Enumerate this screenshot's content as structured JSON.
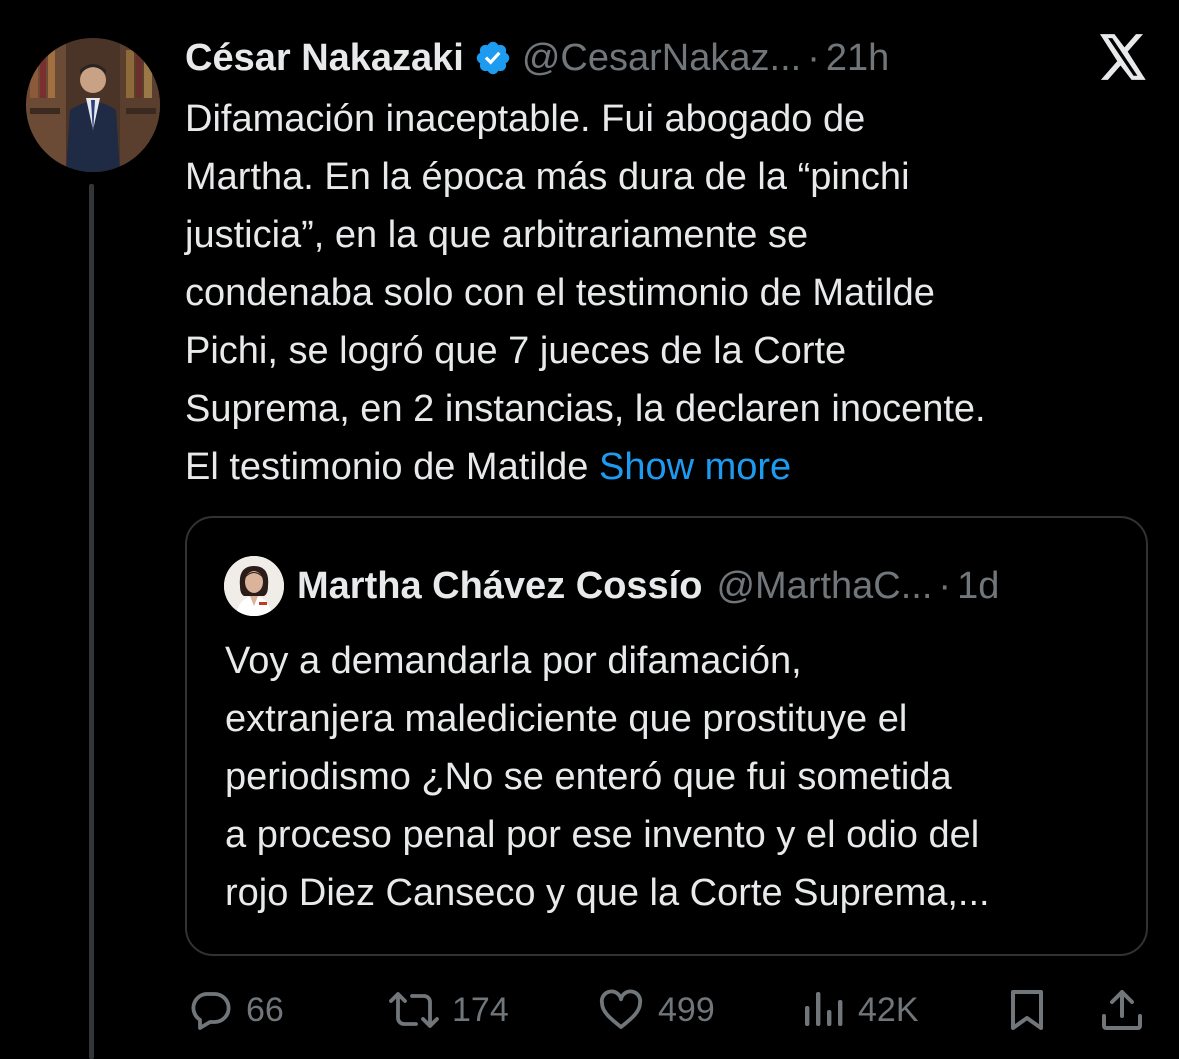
{
  "app": {
    "logo_icon": "x-logo-icon"
  },
  "tweet": {
    "author_name": "César Nakazaki",
    "verified_icon": "verified-badge-icon",
    "handle": "@CesarNakaz...",
    "separator": "·",
    "time": "21h",
    "text_lines": [
      "Difamación inaceptable. Fui abogado de",
      "Martha. En la época más dura de la “pinchi",
      "justicia”, en la que arbitrariamente se",
      "condenaba solo con el testimonio de Matilde",
      "Pichi, se logró que 7 jueces de la Corte",
      "Suprema, en 2 instancias, la declaren inocente.",
      "El testimonio de Matilde"
    ],
    "show_more": "Show more"
  },
  "quoted_tweet": {
    "author_name": "Martha Chávez Cossío",
    "handle": "@MarthaC...",
    "separator": "·",
    "time": "1d",
    "text_lines": [
      "Voy a demandarla por difamación,",
      "extranjera malediciente que prostituye el",
      "periodismo ¿No se enteró que fui sometida",
      "a proceso penal por ese invento y el odio del",
      "rojo Diez Canseco y que la Corte Suprema,..."
    ]
  },
  "actions": {
    "reply": {
      "icon": "reply-icon",
      "count": "66"
    },
    "retweet": {
      "icon": "retweet-icon",
      "count": "174"
    },
    "like": {
      "icon": "heart-icon",
      "count": "499"
    },
    "views": {
      "icon": "views-chart-icon",
      "count": "42K"
    },
    "bookmark": {
      "icon": "bookmark-icon"
    },
    "share": {
      "icon": "share-icon"
    }
  },
  "colors": {
    "background": "#000000",
    "text": "#e7e9ea",
    "secondary": "#71767b",
    "link": "#1d9bf0",
    "border": "#2f3336"
  }
}
